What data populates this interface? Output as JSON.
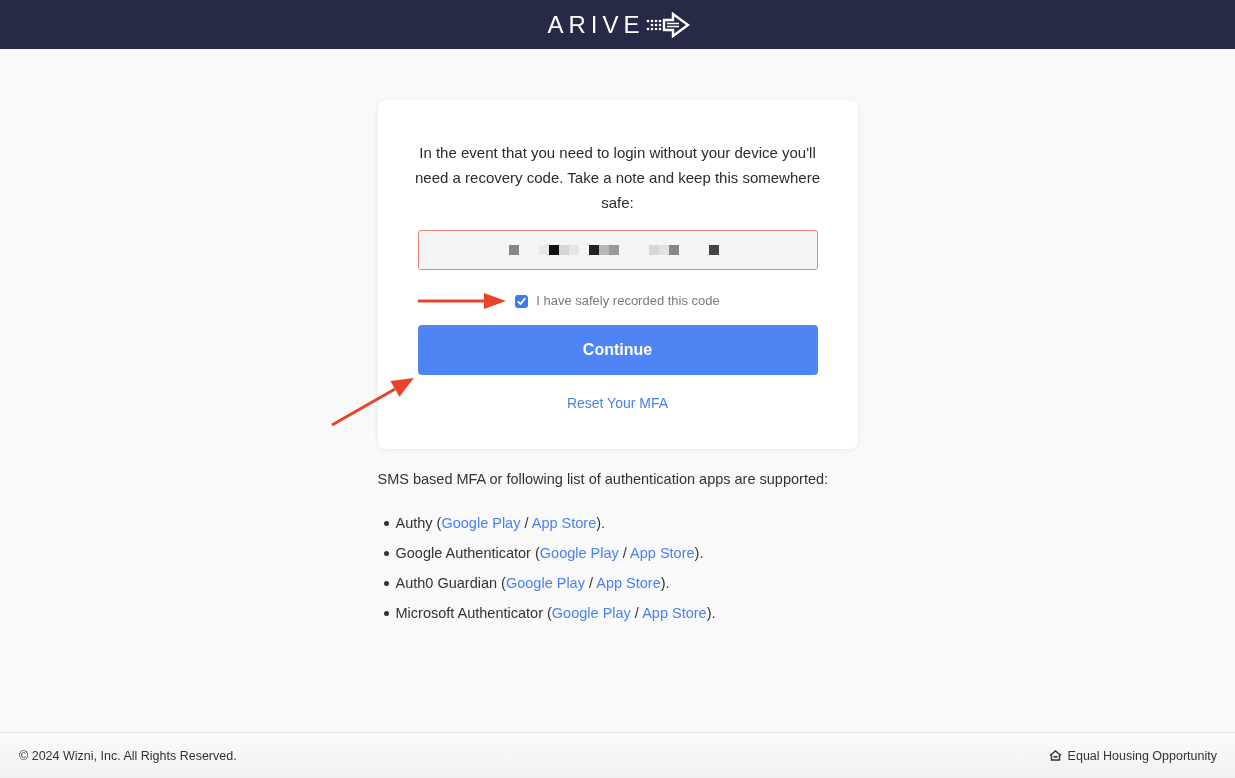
{
  "header": {
    "logo": "ARIVE"
  },
  "card": {
    "message": "In the event that you need to login without your device you'll need a recovery code. Take a note and keep this somewhere safe:",
    "confirm": {
      "label": "I have safely recorded this code",
      "checked": true
    },
    "continue_button": "Continue",
    "reset_link": "Reset Your MFA"
  },
  "annotation_arrows": [
    {
      "kind": "horizontal"
    },
    {
      "kind": "diagonal"
    }
  ],
  "supported_apps": {
    "intro": "SMS based MFA or following list of authentication apps are supported:",
    "items": [
      {
        "parts": [
          {
            "kind": "text",
            "text": "Authy ("
          },
          {
            "kind": "link",
            "text": "Google Play"
          },
          {
            "kind": "text",
            "text": " / "
          },
          {
            "kind": "link",
            "text": "App Store"
          },
          {
            "kind": "text",
            "text": ")."
          }
        ]
      },
      {
        "parts": [
          {
            "kind": "text",
            "text": "Google Authenticator ("
          },
          {
            "kind": "link",
            "text": "Google Play"
          },
          {
            "kind": "text",
            "text": " / "
          },
          {
            "kind": "link",
            "text": "App Store"
          },
          {
            "kind": "text",
            "text": ")."
          }
        ]
      },
      {
        "parts": [
          {
            "kind": "text",
            "text": "Auth0 Guardian ("
          },
          {
            "kind": "link",
            "text": "Google Play"
          },
          {
            "kind": "text",
            "text": " / "
          },
          {
            "kind": "link",
            "text": "App Store"
          },
          {
            "kind": "text",
            "text": ")."
          }
        ]
      },
      {
        "parts": [
          {
            "kind": "text",
            "text": "Microsoft Authenticator ("
          },
          {
            "kind": "link",
            "text": "Google Play"
          },
          {
            "kind": "text",
            "text": " / "
          },
          {
            "kind": "link",
            "text": "App Store"
          },
          {
            "kind": "text",
            "text": ")."
          }
        ]
      }
    ]
  },
  "footer": {
    "copyright": "© 2024 Wizni, Inc. All Rights Reserved.",
    "notice": "Equal Housing Opportunity"
  }
}
